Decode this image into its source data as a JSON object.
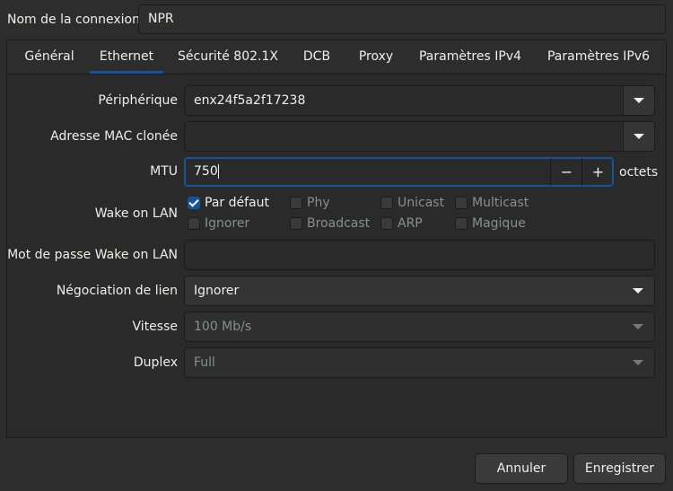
{
  "connection": {
    "name_label": "Nom de la connexion",
    "name_value": "NPR"
  },
  "tabs": [
    {
      "label": "Général",
      "active": false
    },
    {
      "label": "Ethernet",
      "active": true
    },
    {
      "label": "Sécurité 802.1X",
      "active": false
    },
    {
      "label": "DCB",
      "active": false
    },
    {
      "label": "Proxy",
      "active": false
    },
    {
      "label": "Paramètres IPv4",
      "active": false
    },
    {
      "label": "Paramètres IPv6",
      "active": false
    }
  ],
  "ethernet": {
    "device_label": "Périphérique",
    "device_value": "enx24f5a2f17238",
    "mac_label": "Adresse MAC clonée",
    "mac_value": "",
    "mtu_label": "MTU",
    "mtu_value": "750",
    "mtu_minus": "−",
    "mtu_plus": "+",
    "mtu_unit": "octets",
    "wol_label": "Wake on LAN",
    "wol_options": [
      {
        "label": "Par défaut",
        "checked": true
      },
      {
        "label": "Phy",
        "checked": false
      },
      {
        "label": "Unicast",
        "checked": false
      },
      {
        "label": "Multicast",
        "checked": false
      },
      {
        "label": "Ignorer",
        "checked": false
      },
      {
        "label": "Broadcast",
        "checked": false
      },
      {
        "label": "ARP",
        "checked": false
      },
      {
        "label": "Magique",
        "checked": false
      }
    ],
    "wol_password_label": "Mot de passe Wake on LAN",
    "wol_password_value": "",
    "negotiation_label": "Négociation de lien",
    "negotiation_value": "Ignorer",
    "speed_label": "Vitesse",
    "speed_value": "100 Mb/s",
    "duplex_label": "Duplex",
    "duplex_value": "Full"
  },
  "buttons": {
    "cancel": "Annuler",
    "save": "Enregistrer"
  },
  "colors": {
    "accent": "#15539e",
    "background": "#2d2d2d",
    "text": "#eeeeec",
    "disabled_text": "#8b8e8f"
  }
}
